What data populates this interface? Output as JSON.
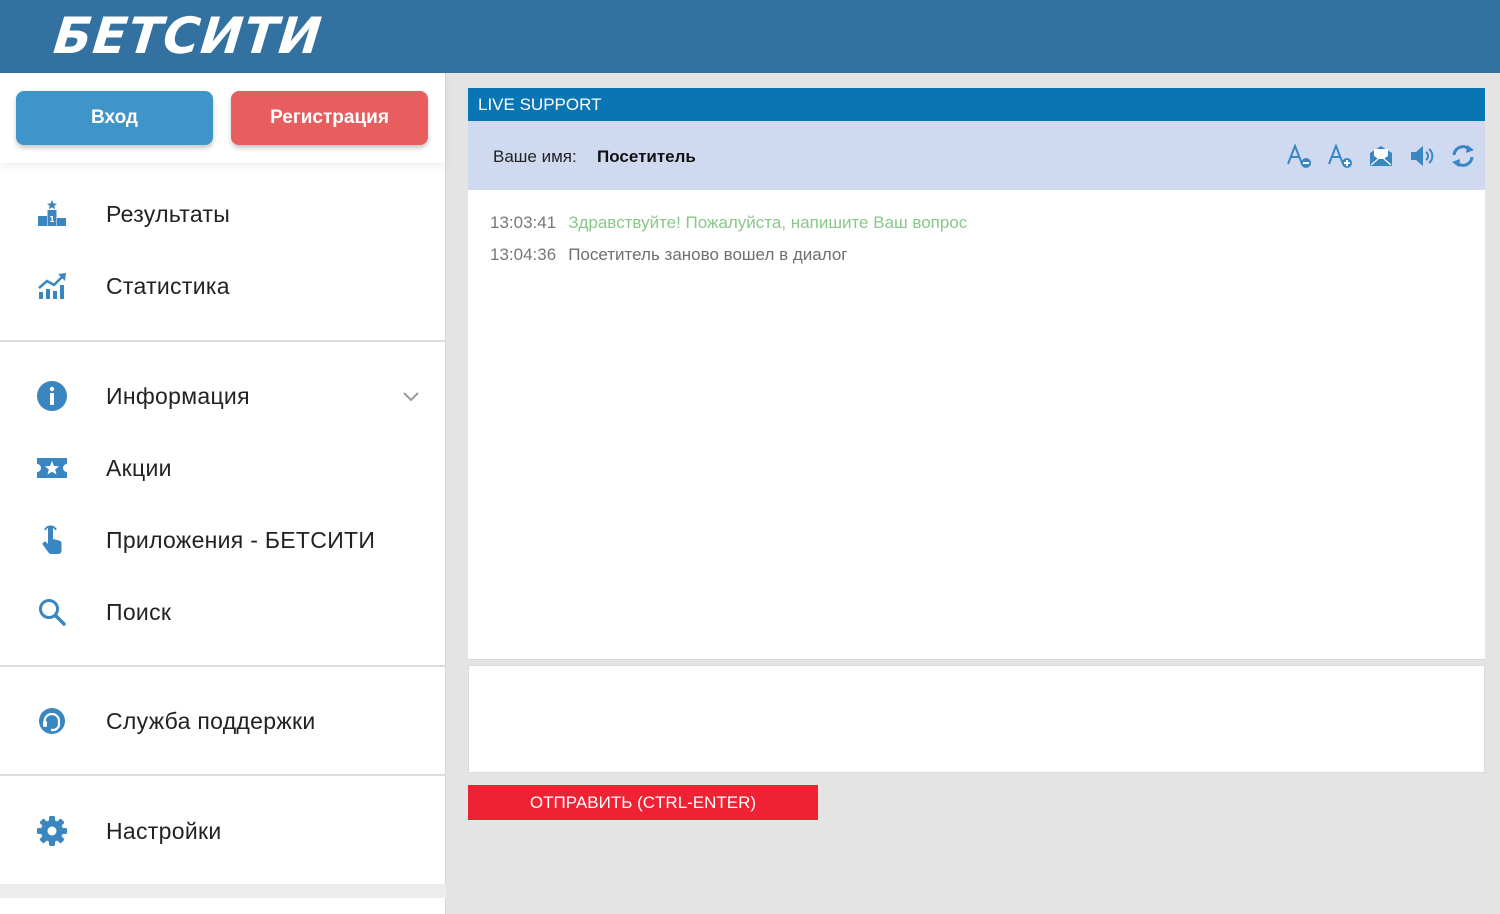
{
  "header": {
    "logo": "БЕТСИТИ"
  },
  "auth": {
    "login_label": "Вход",
    "register_label": "Регистрация"
  },
  "menu": {
    "items": [
      {
        "label": "Результаты",
        "icon": "podium-icon"
      },
      {
        "label": "Статистика",
        "icon": "chart-icon"
      },
      {
        "label": "Информация",
        "icon": "info-icon"
      },
      {
        "label": "Акции",
        "icon": "ticket-star-icon"
      },
      {
        "label": "Приложения - БЕТСИТИ",
        "icon": "hand-pointer-icon"
      },
      {
        "label": "Поиск",
        "icon": "search-icon"
      },
      {
        "label": "Служба поддержки",
        "icon": "support-icon"
      },
      {
        "label": "Настройки",
        "icon": "gear-icon"
      }
    ]
  },
  "chat": {
    "title": "LIVE SUPPORT",
    "name_label": "Ваше имя:",
    "name_value": "Посетитель",
    "tools": [
      "font-decrease-icon",
      "font-increase-icon",
      "email-icon",
      "sound-icon",
      "refresh-icon"
    ],
    "messages": [
      {
        "time": "13:03:41",
        "text": "Здравствуйте! Пожалуйста, напишите Ваш вопрос"
      },
      {
        "time": "13:04:36",
        "text": "Посетитель заново вошел в диалог"
      }
    ],
    "input_value": "",
    "send_label": "ОТПРАВИТЬ (CTRL-ENTER)"
  },
  "colors": {
    "header_bg": "#3371a1",
    "accent_blue": "#3f95c9",
    "accent_red": "#e85e5e",
    "panel_head": "#0a75b3",
    "send_red": "#ee2232",
    "icon_blue": "#3a86c0"
  }
}
